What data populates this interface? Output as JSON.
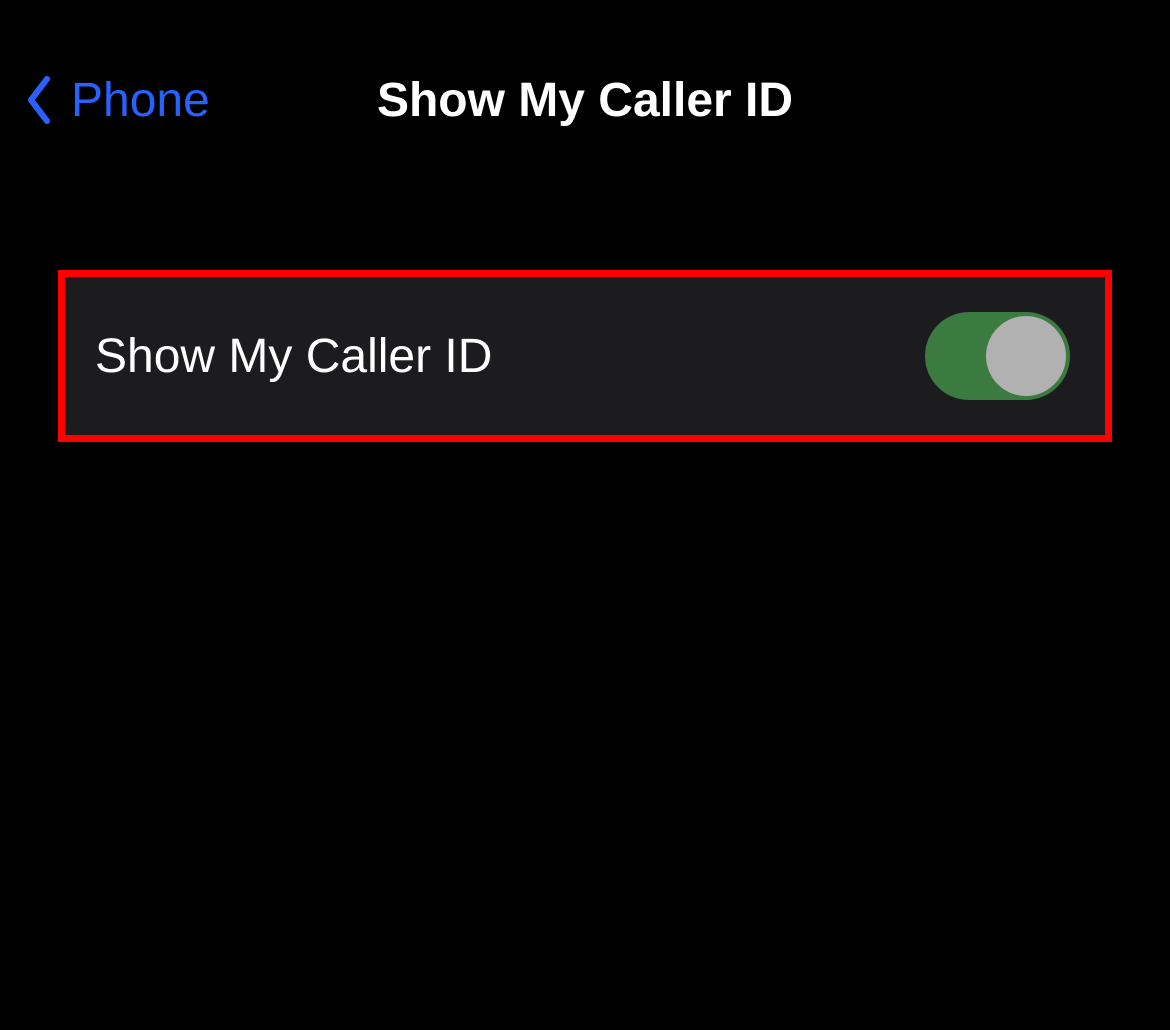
{
  "nav": {
    "back_label": "Phone",
    "title": "Show My Caller ID"
  },
  "settings": {
    "caller_id": {
      "label": "Show My Caller ID",
      "enabled": true
    }
  }
}
